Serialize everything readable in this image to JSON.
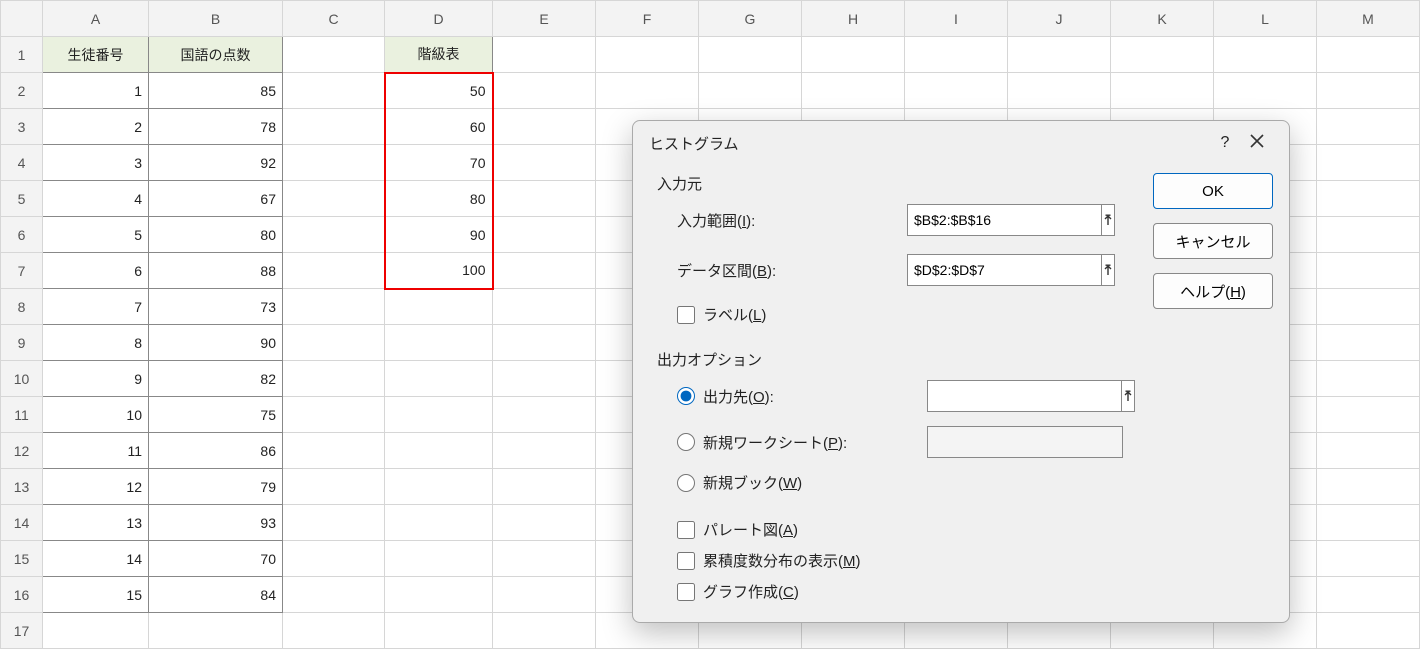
{
  "cols": [
    "A",
    "B",
    "C",
    "D",
    "E",
    "F",
    "G",
    "H",
    "I",
    "J",
    "K",
    "L",
    "M"
  ],
  "rowcount": 17,
  "table": {
    "headers": {
      "A": "生徒番号",
      "B": "国語の点数",
      "D": "階級表"
    },
    "rows": [
      {
        "A": "1",
        "B": "85",
        "D": "50"
      },
      {
        "A": "2",
        "B": "78",
        "D": "60"
      },
      {
        "A": "3",
        "B": "92",
        "D": "70"
      },
      {
        "A": "4",
        "B": "67",
        "D": "80"
      },
      {
        "A": "5",
        "B": "80",
        "D": "90"
      },
      {
        "A": "6",
        "B": "88",
        "D": "100"
      },
      {
        "A": "7",
        "B": "73"
      },
      {
        "A": "8",
        "B": "90"
      },
      {
        "A": "9",
        "B": "82"
      },
      {
        "A": "10",
        "B": "75"
      },
      {
        "A": "11",
        "B": "86"
      },
      {
        "A": "12",
        "B": "79"
      },
      {
        "A": "13",
        "B": "93"
      },
      {
        "A": "14",
        "B": "70"
      },
      {
        "A": "15",
        "B": "84"
      }
    ]
  },
  "dialog": {
    "title": "ヒストグラム",
    "input_group": "入力元",
    "input_range_label": "入力範囲(I):",
    "input_range_value": "$B$2:$B$16",
    "bin_range_label": "データ区間(B):",
    "bin_range_value": "$D$2:$D$7",
    "labels_check": "ラベル(L)",
    "output_group": "出力オプション",
    "output_ref_label": "出力先(O):",
    "output_ref_value": "",
    "new_sheet_label": "新規ワークシート(P):",
    "new_sheet_value": "",
    "new_book_label": "新規ブック(W)",
    "pareto_label": "パレート図(A)",
    "cumulative_label": "累積度数分布の表示(M)",
    "chart_label": "グラフ作成(C)",
    "ok": "OK",
    "cancel": "キャンセル",
    "help": "ヘルプ(H)"
  }
}
